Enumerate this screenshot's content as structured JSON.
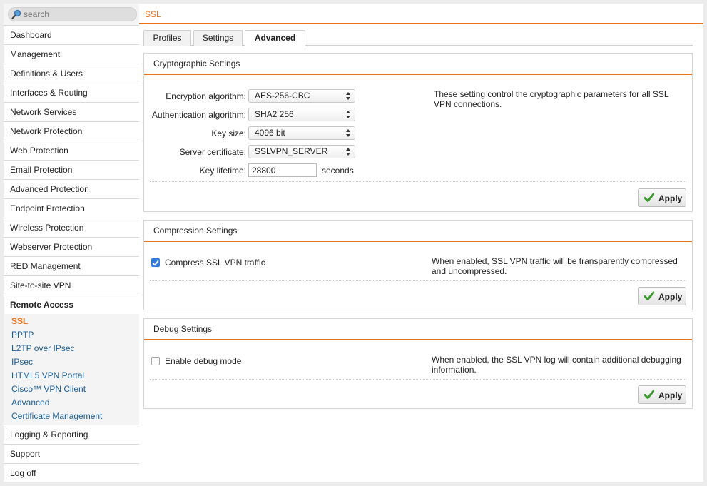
{
  "search": {
    "placeholder": "search"
  },
  "sidebar": {
    "items_top": [
      "Dashboard",
      "Management",
      "Definitions & Users",
      "Interfaces & Routing",
      "Network Services",
      "Network Protection",
      "Web Protection",
      "Email Protection",
      "Advanced Protection",
      "Endpoint Protection",
      "Wireless Protection",
      "Webserver Protection",
      "RED Management",
      "Site-to-site VPN"
    ],
    "remote_access": "Remote Access",
    "sub_items": [
      "SSL",
      "PPTP",
      "L2TP over IPsec",
      "IPsec",
      "HTML5 VPN Portal",
      "Cisco™ VPN Client",
      "Advanced",
      "Certificate Management"
    ],
    "items_bottom": [
      "Logging & Reporting",
      "Support",
      "Log off"
    ]
  },
  "page": {
    "title": "SSL"
  },
  "tabs": [
    {
      "label": "Profiles"
    },
    {
      "label": "Settings"
    },
    {
      "label": "Advanced"
    }
  ],
  "crypto": {
    "header": "Cryptographic Settings",
    "encryption_label": "Encryption algorithm:",
    "encryption_value": "AES-256-CBC",
    "auth_label": "Authentication algorithm:",
    "auth_value": "SHA2 256",
    "keysize_label": "Key size:",
    "keysize_value": "4096 bit",
    "cert_label": "Server certificate:",
    "cert_value": "SSLVPN_SERVER",
    "lifetime_label": "Key lifetime:",
    "lifetime_value": "28800",
    "lifetime_unit": "seconds",
    "help_line1": "These setting control the cryptographic parameters for all SSL",
    "help_line2": "VPN connections.",
    "apply": "Apply"
  },
  "compression": {
    "header": "Compression Settings",
    "checkbox_label": "Compress SSL VPN traffic",
    "checked": true,
    "help_line1": "When enabled, SSL VPN traffic will be transparently compressed",
    "help_line2": "and uncompressed.",
    "apply": "Apply"
  },
  "debug": {
    "header": "Debug Settings",
    "checkbox_label": "Enable debug mode",
    "checked": false,
    "help_line1": "When enabled, the SSL VPN log will contain additional debugging",
    "help_line2": "information.",
    "apply": "Apply"
  },
  "colors": {
    "accent": "#e9731c",
    "link": "#1a5d98",
    "check": "#2f7bdb",
    "apply_check": "#3a9a2b"
  }
}
